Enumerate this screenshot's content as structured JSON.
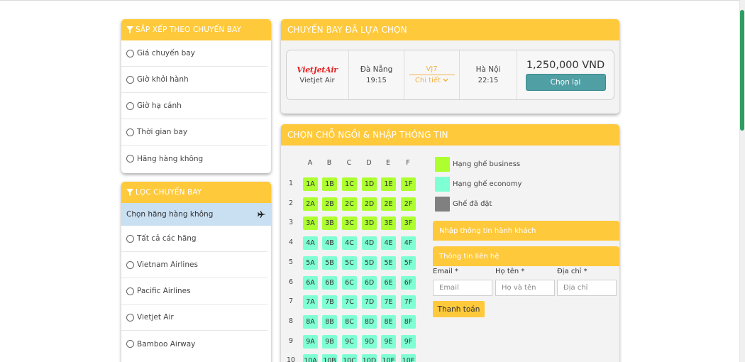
{
  "sort": {
    "title": "SẮP XẾP THEO CHUYẾN BAY",
    "options": [
      "Giá chuyến bay",
      "Giờ khởi hành",
      "Giờ hạ cánh",
      "Thời gian bay",
      "Hãng hàng không"
    ]
  },
  "filter": {
    "title": "LỌC CHUYẾN BAY",
    "airline_header": "Chọn hãng hàng không",
    "options": [
      "Tất cả các hãng",
      "Vietnam Airlines",
      "Pacific Airlines",
      "Vietjet Air",
      "Bamboo Airway"
    ]
  },
  "flight": {
    "title": "CHUYẾN BAY ĐÃ LỰA CHỌN",
    "logo_text": "VietJetAir",
    "airline": "Vietjet Air",
    "from_city": "Đà Nẵng",
    "from_time": "19:15",
    "flight_code": "VJ7",
    "details_label": "Chi tiết",
    "to_city": "Hà Nội",
    "to_time": "22:15",
    "price": "1,250,000 VND",
    "reselect_label": "Chọn lại"
  },
  "seats": {
    "title": "CHỌN CHỖ NGỒI & NHẬP THÔNG TIN",
    "columns": [
      "A",
      "B",
      "C",
      "D",
      "E",
      "F"
    ],
    "rows": [
      "1",
      "2",
      "3",
      "4",
      "5",
      "6",
      "7",
      "8",
      "9",
      "10"
    ],
    "business_rows": 3
  },
  "legend": {
    "business": "Hạng ghế business",
    "economy": "Hạng ghế economy",
    "booked": "Ghế đã đặt"
  },
  "passenger": {
    "title": "Nhập thông tin hành khách"
  },
  "contact": {
    "title": "Thông tin liên hệ",
    "email_label": "Email *",
    "email_placeholder": "Email",
    "name_label": "Họ tên *",
    "name_placeholder": "Họ và tên",
    "address_label": "Địa chỉ *",
    "address_placeholder": "Địa chỉ",
    "pay_label": "Thanh toán"
  },
  "colors": {
    "accent": "#ffc93c",
    "business_seat": "#adff2f",
    "economy_seat": "#7fffd4",
    "booked_seat": "#808080",
    "button_teal": "#4f9fa5",
    "filter_highlight": "#c9dff2"
  }
}
